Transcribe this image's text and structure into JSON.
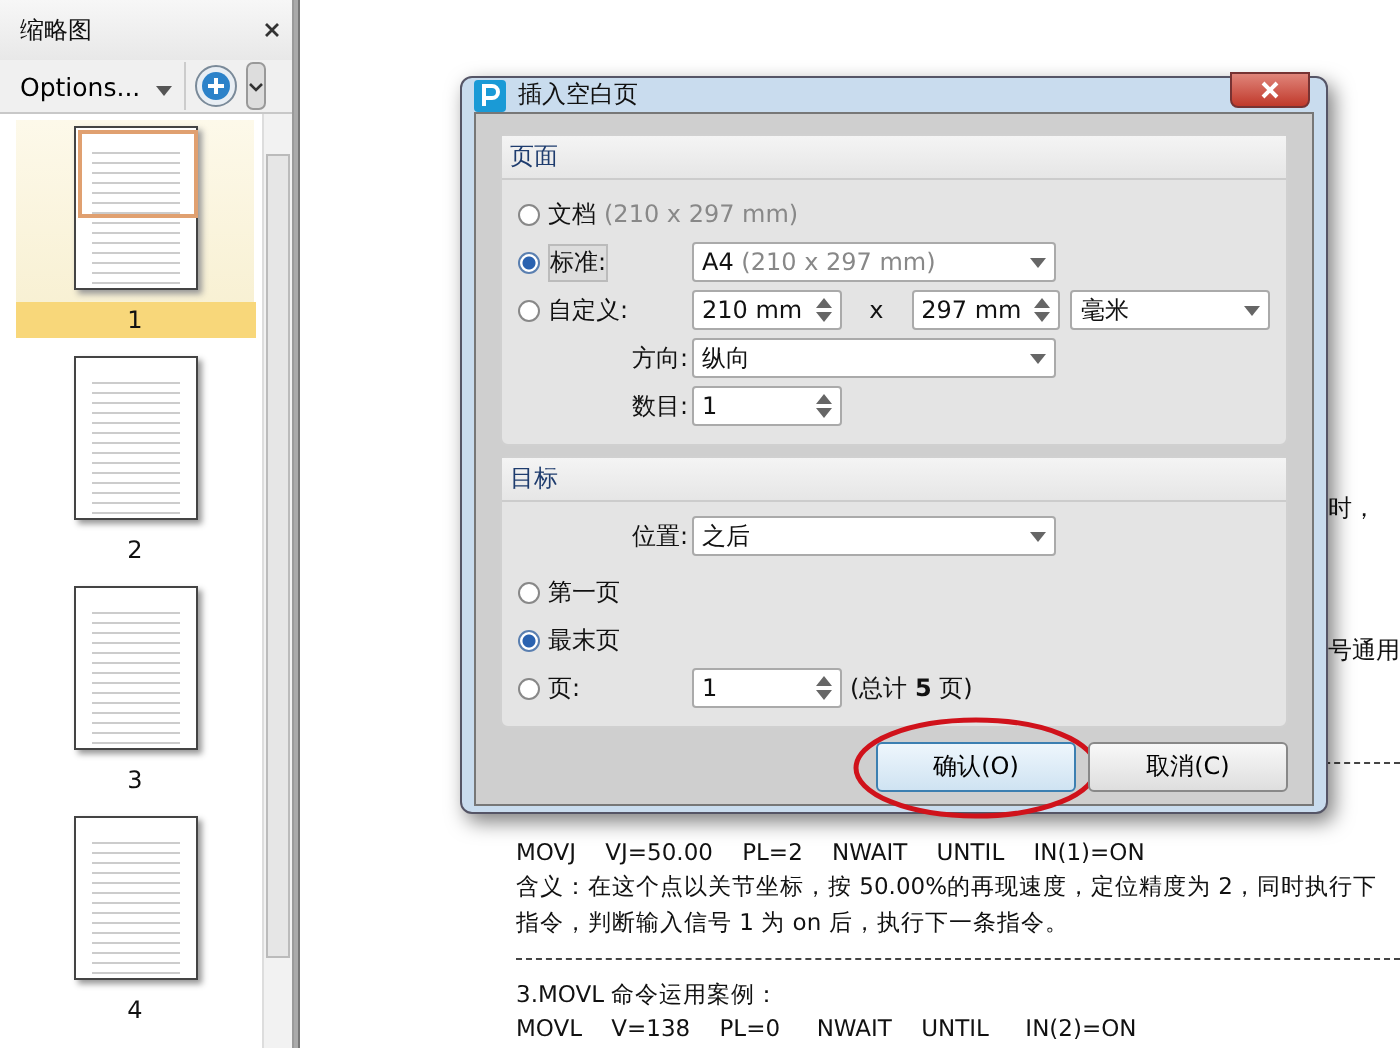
{
  "thumbnail_panel": {
    "title": "缩略图",
    "options_label": "Options...",
    "pages": [
      {
        "label": "1",
        "selected": true
      },
      {
        "label": "2",
        "selected": false
      },
      {
        "label": "3",
        "selected": false
      },
      {
        "label": "4",
        "selected": false
      }
    ]
  },
  "document": {
    "lines": [
      {
        "kind": "fragment",
        "text": "时，"
      },
      {
        "kind": "fragment",
        "text": "号通用"
      },
      {
        "kind": "rule"
      },
      {
        "kind": "text",
        "text": "MOVJ    VJ=50.00    PL=2    NWAIT    UNTIL    IN(1)=ON"
      },
      {
        "kind": "text",
        "text": "含义：在这个点以关节坐标，按 50.00%的再现速度，定位精度为 2，同时执行下"
      },
      {
        "kind": "text",
        "text": "指令，判断输入信号 1 为 on 后，执行下一条指令。"
      },
      {
        "kind": "rule"
      },
      {
        "kind": "text",
        "text": "3.MOVL 命令运用案例："
      },
      {
        "kind": "text",
        "text": "MOVL    V=138    PL=0     NWAIT    UNTIL     IN(2)=ON"
      }
    ]
  },
  "dialog": {
    "title": "插入空白页",
    "page_group": {
      "title": "页面",
      "size_options": [
        {
          "kind": "document",
          "label": "文档",
          "detail": "(210 x 297 mm)",
          "selected": false
        },
        {
          "kind": "standard",
          "label": "标准:",
          "selected": true,
          "value": "A4",
          "detail": "(210 x 297 mm)"
        },
        {
          "kind": "custom",
          "label": "自定义:",
          "selected": false,
          "width": "210 mm",
          "separator": "x",
          "height": "297 mm",
          "unit": "毫米"
        }
      ],
      "orientation": {
        "label": "方向:",
        "value": "纵向"
      },
      "count": {
        "label": "数目:",
        "value": "1"
      }
    },
    "target_group": {
      "title": "目标",
      "position": {
        "label": "位置:",
        "value": "之后"
      },
      "options": [
        {
          "kind": "first",
          "label": "第一页",
          "selected": false
        },
        {
          "kind": "last",
          "label": "最末页",
          "selected": true
        },
        {
          "kind": "page",
          "label": "页:",
          "selected": false,
          "value": "1",
          "note": "(总计 **5** 页)"
        }
      ]
    },
    "buttons": [
      {
        "label": "确认(O)",
        "focused": true,
        "highlighted": true
      },
      {
        "label": "取消(C)",
        "focused": false,
        "highlighted": false
      }
    ]
  }
}
